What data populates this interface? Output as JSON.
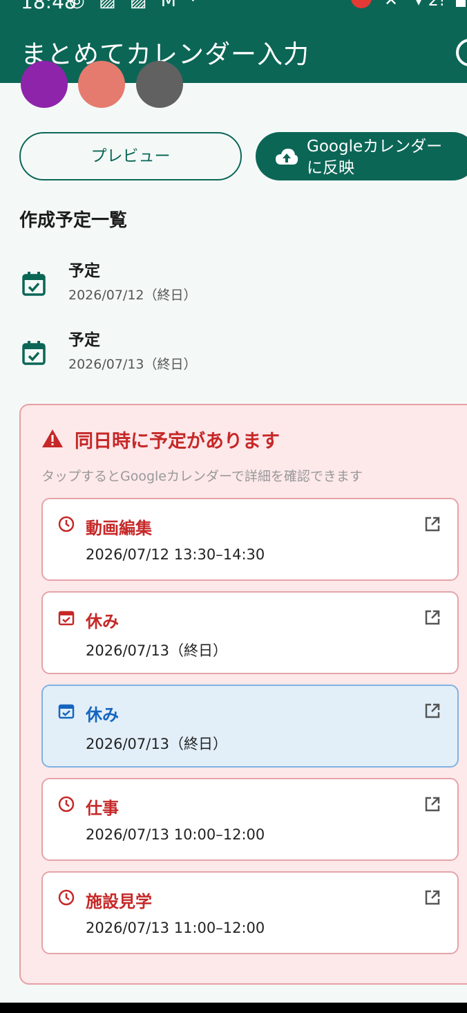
{
  "status_bar": {
    "time": "18:48",
    "icons_text": "◎ ▨ ▨ M ·",
    "mute_icon": "mute-icon",
    "battery_text": "▾ 2!"
  },
  "app_bar": {
    "title": "まとめてカレンダー入力",
    "help_icon": "help-circle-icon"
  },
  "swatches": [
    {
      "color": "#8e24aa"
    },
    {
      "color": "#e57b6e"
    },
    {
      "color": "#616161"
    }
  ],
  "actions": {
    "preview_label": "プレビュー",
    "google_label_line1": "Googleカレンダー",
    "google_label_line2": "に反映",
    "google_icon": "cloud-upload-icon"
  },
  "list": {
    "title": "作成予定一覧",
    "items": [
      {
        "icon": "calendar-check-icon",
        "title": "予定",
        "date": "2026/07/12（終日）"
      },
      {
        "icon": "calendar-check-icon",
        "title": "予定",
        "date": "2026/07/13（終日）"
      }
    ]
  },
  "conflict": {
    "title": "同日時に予定があります",
    "subtitle": "タップするとGoogleカレンダーで詳細を確認できます",
    "items": [
      {
        "icon": "clock-icon",
        "title": "動画編集",
        "datetime": "2026/07/12  13:30–14:30",
        "selected": false
      },
      {
        "icon": "calendar-check-icon",
        "title": "休み",
        "datetime": "2026/07/13（終日）",
        "selected": false
      },
      {
        "icon": "calendar-check-icon",
        "title": "休み",
        "datetime": "2026/07/13（終日）",
        "selected": true
      },
      {
        "icon": "clock-icon",
        "title": "仕事",
        "datetime": "2026/07/13  10:00–12:00",
        "selected": false
      },
      {
        "icon": "clock-icon",
        "title": "施設見学",
        "datetime": "2026/07/13  11:00–12:00",
        "selected": false
      }
    ]
  },
  "colors": {
    "primary": "#0b6656",
    "error": "#c62828",
    "selected_text": "#1565c0"
  }
}
